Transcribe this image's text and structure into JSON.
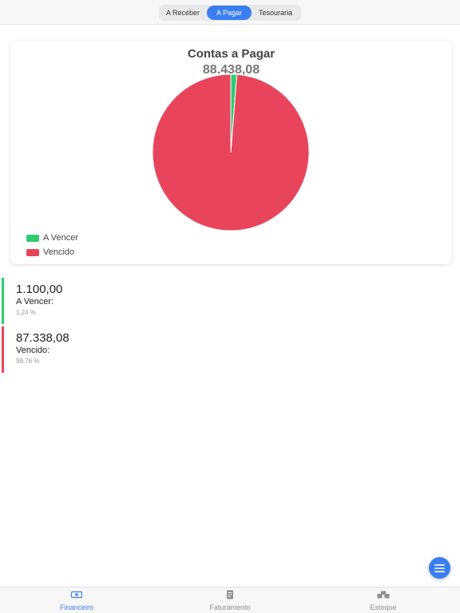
{
  "segments": [
    "A Receber",
    "A Pagar",
    "Tesouraria"
  ],
  "selected_segment": "A Pagar",
  "chart_data": {
    "type": "pie",
    "title": "Contas a Pagar",
    "subtitle": "88.438,08",
    "categories": [
      "A Vencer",
      "Vencido"
    ],
    "values": [
      1100.0,
      87338.08
    ],
    "percentages": [
      1.24,
      98.76
    ],
    "colors": [
      "#2ecc71",
      "#e8455c"
    ],
    "legend_position": "bottom-left"
  },
  "legend": [
    {
      "label": "A Vencer",
      "color": "#2ecc71"
    },
    {
      "label": "Vencido",
      "color": "#e8455c"
    }
  ],
  "rows": [
    {
      "value": "1.100,00",
      "label": "A Vencer:",
      "percent": "1,24 %",
      "color": "#2ecc71"
    },
    {
      "value": "87.338,08",
      "label": "Vencido:",
      "percent": "98,76 %",
      "color": "#e8455c"
    }
  ],
  "fab": {
    "icon": "menu-icon"
  },
  "tabs": [
    {
      "label": "Financeiro",
      "icon": "money-icon",
      "active": true
    },
    {
      "label": "Faturamento",
      "icon": "invoice-icon",
      "active": false
    },
    {
      "label": "Estoque",
      "icon": "boxes-icon",
      "active": false
    }
  ]
}
